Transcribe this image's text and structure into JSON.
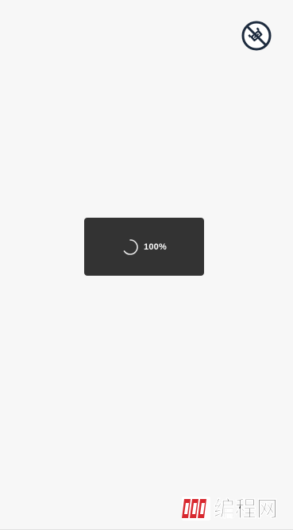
{
  "music_toggle": {
    "icon": "music-off-icon",
    "color": "#1d2b3e"
  },
  "loading_toast": {
    "progress_text": "100%",
    "spinner_icon": "spinner-icon",
    "background": "#333333"
  },
  "watermark": {
    "brand_text": "编程网",
    "logo_text": "php",
    "logo_color": "#d8282f"
  }
}
